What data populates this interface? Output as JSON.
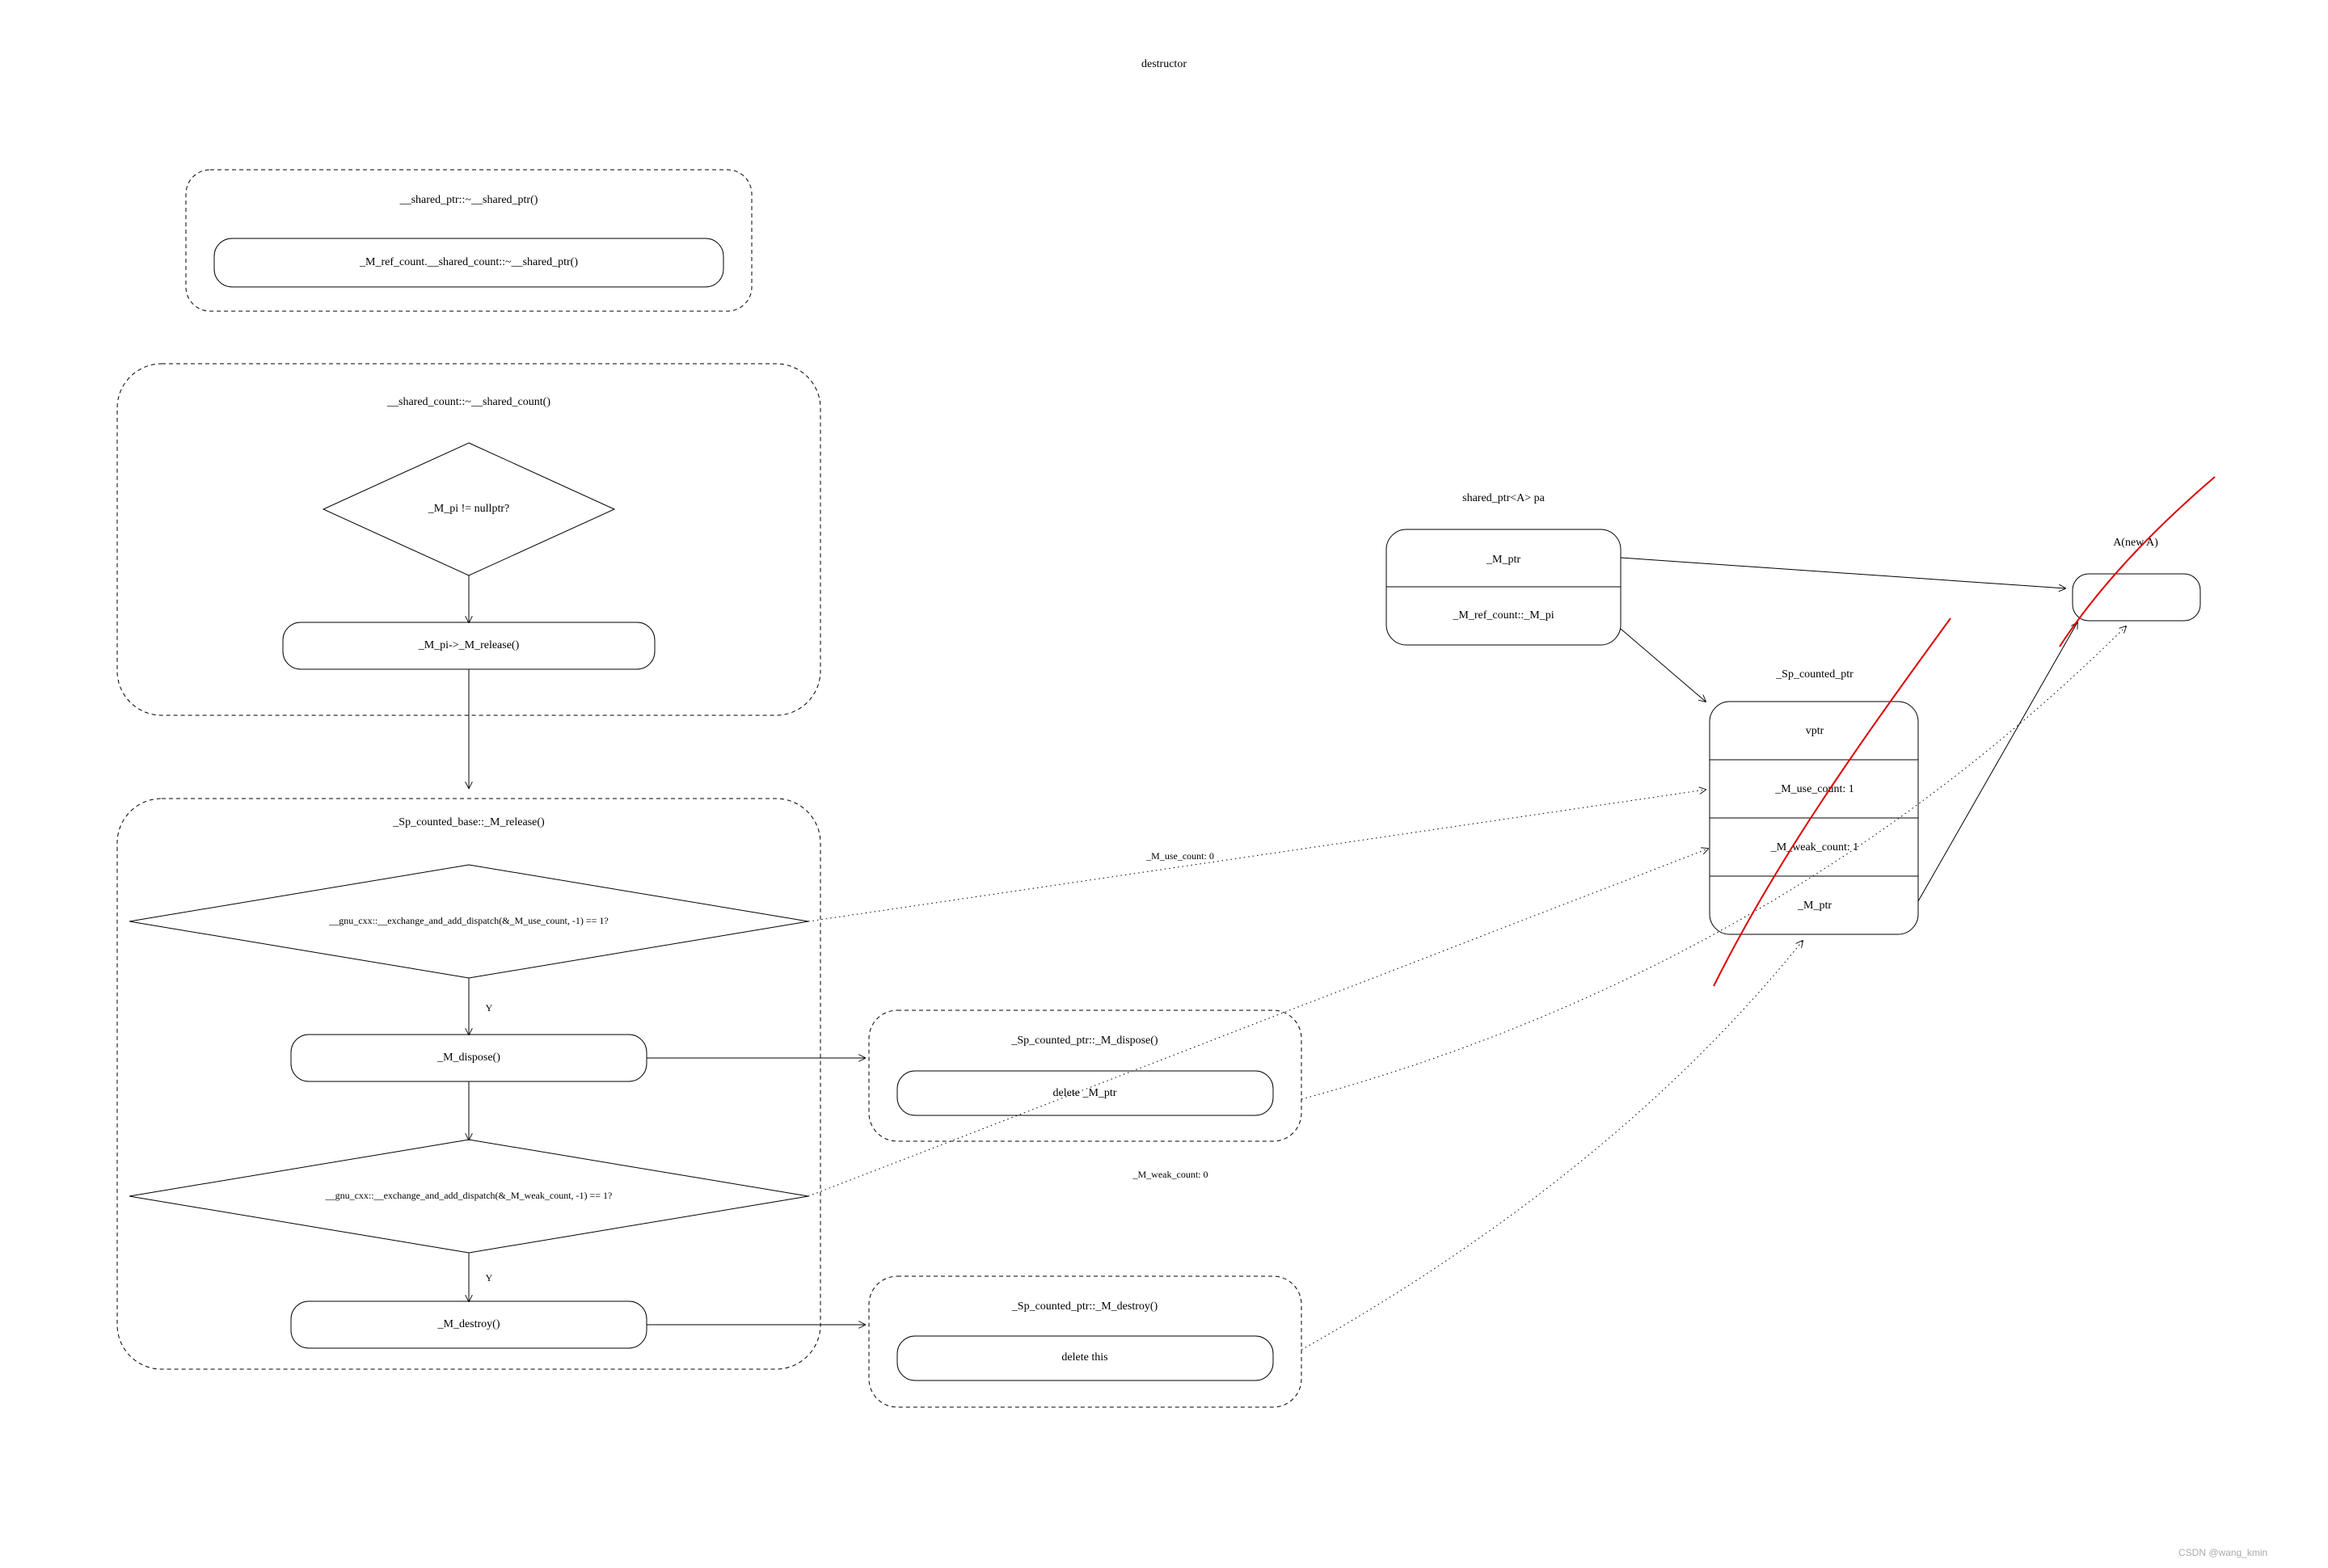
{
  "title": "destructor",
  "box1": {
    "line1": "__shared_ptr::~__shared_ptr()",
    "line2": "_M_ref_count.__shared_count::~__shared_ptr()"
  },
  "box2": {
    "title": "__shared_count::~__shared_count()",
    "decision": "_M_pi != nullptr?",
    "action": "_M_pi->_M_release()"
  },
  "box3": {
    "title": "_Sp_counted_base::_M_release()",
    "dec1": "__gnu_cxx::__exchange_and_add_dispatch(&_M_use_count, -1) == 1?",
    "yes1": "Y",
    "act1": "_M_dispose()",
    "dec2": "__gnu_cxx::__exchange_and_add_dispatch(&_M_weak_count, -1) == 1?",
    "yes2": "Y",
    "act2": "_M_destroy()"
  },
  "dispose": {
    "title": "_Sp_counted_ptr::_M_dispose()",
    "body": "delete _M_ptr"
  },
  "destroy": {
    "title": "_Sp_counted_ptr::_M_destroy()",
    "body": "delete this"
  },
  "obj": {
    "pa_title": "shared_ptr<A> pa",
    "pa_r1": "_M_ptr",
    "pa_r2": "_M_ref_count::_M_pi",
    "sp_title": "_Sp_counted_ptr",
    "sp_r1": "vptr",
    "sp_r2": "_M_use_count: 1",
    "sp_r3": "_M_weak_count: 1",
    "sp_r4": "_M_ptr",
    "a_title": "A(new A)"
  },
  "notes": {
    "use0": "_M_use_count: 0",
    "weak0": "_M_weak_count: 0"
  },
  "watermark": "CSDN @wang_kmin"
}
